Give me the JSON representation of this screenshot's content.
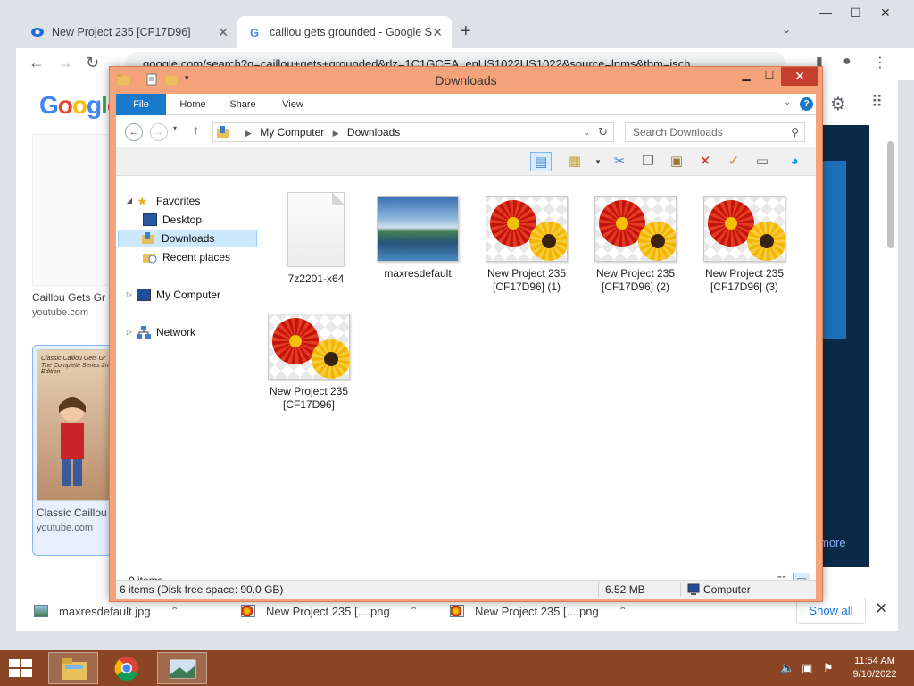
{
  "browser": {
    "tabs": [
      {
        "title": "New Project 235 [CF17D96]"
      },
      {
        "title": "caillou gets grounded - Google S"
      }
    ],
    "url": "google.com/search?q=caillou+gets+grounded&rlz=1C1GCEA_enUS1022US1022&source=lnms&tbm=isch",
    "results": [
      {
        "title": "Caillou Gets Gr",
        "site": "youtube.com"
      },
      {
        "title": "Classic Caillou",
        "site": "youtube.com",
        "poster_text": "Classic Caillou Gets Gr The Complete Series 2nd Edition"
      }
    ],
    "right_text": "more",
    "downloads": [
      {
        "name": "maxresdefault.jpg"
      },
      {
        "name": "New Project 235 [....png"
      },
      {
        "name": "New Project 235 [....png"
      }
    ],
    "show_all_label": "Show all"
  },
  "explorer": {
    "title": "Downloads",
    "ribbon_tabs": [
      "File",
      "Home",
      "Share",
      "View"
    ],
    "breadcrumb": [
      "My Computer",
      "Downloads"
    ],
    "search_placeholder": "Search Downloads",
    "nav": {
      "favorites": "Favorites",
      "desktop": "Desktop",
      "downloads": "Downloads",
      "recent": "Recent places",
      "computer": "My Computer",
      "network": "Network"
    },
    "files": [
      {
        "name": "7z2201-x64",
        "kind": "document"
      },
      {
        "name": "maxresdefault",
        "kind": "landscape"
      },
      {
        "name": "New Project 235 [CF17D96] (1)",
        "kind": "flower"
      },
      {
        "name": "New Project 235 [CF17D96] (2)",
        "kind": "flower"
      },
      {
        "name": "New Project 235 [CF17D96] (3)",
        "kind": "flower"
      },
      {
        "name": "New Project 235 [CF17D96]",
        "kind": "flower"
      }
    ],
    "selection_status": "0 items",
    "status_items": "6 items (Disk free space: 90.0 GB)",
    "status_size": "6.52 MB",
    "status_location": "Computer"
  },
  "taskbar": {
    "time": "11:54 AM",
    "date": "9/10/2022"
  },
  "colors": {
    "explorer_frame": "#f4a37b",
    "ribbon_file": "#1979ca",
    "close_button": "#c7402f",
    "taskbar": "#8a4524"
  }
}
